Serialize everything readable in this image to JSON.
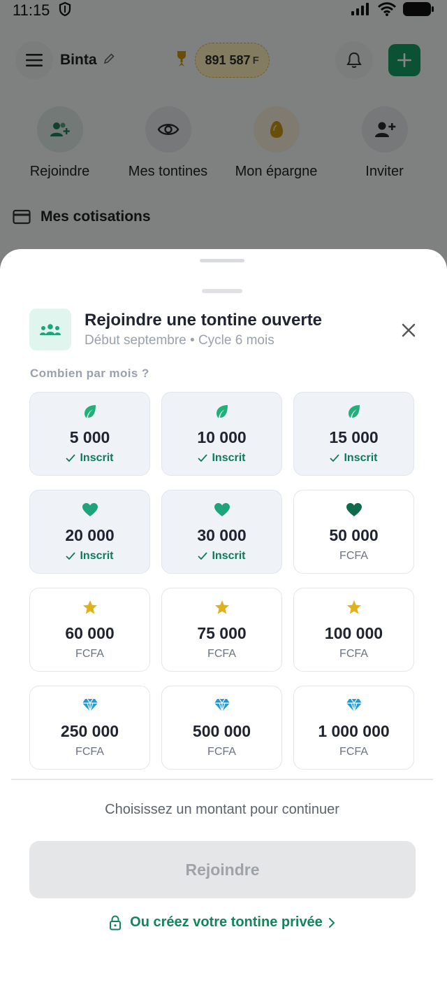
{
  "status_bar": {
    "time": "11:15"
  },
  "header": {
    "user_name": "Binta",
    "balance_amount": "891 587",
    "balance_currency": "F"
  },
  "quick_actions": [
    {
      "label": "Rejoindre",
      "icon": "user-plus-group-icon",
      "color": "#1d7f5a"
    },
    {
      "label": "Mes tontines",
      "icon": "eye-icon",
      "color": "#2b2b2b"
    },
    {
      "label": "Mon épargne",
      "icon": "egg-icon",
      "color": "#c99414"
    },
    {
      "label": "Inviter",
      "icon": "add-user-icon",
      "color": "#2b2b2b"
    }
  ],
  "section": {
    "title": "Mes cotisations"
  },
  "sheet": {
    "title": "Rejoindre une tontine ouverte",
    "subtitle": "Début septembre • Cycle 6 mois",
    "question": "Combien par mois ?",
    "options": [
      {
        "amount": "5 000",
        "tier_icon": "leaf-icon",
        "subscribed": true,
        "footer": "Inscrit"
      },
      {
        "amount": "10 000",
        "tier_icon": "leaf-icon",
        "subscribed": true,
        "footer": "Inscrit"
      },
      {
        "amount": "15 000",
        "tier_icon": "leaf-icon",
        "subscribed": true,
        "footer": "Inscrit"
      },
      {
        "amount": "20 000",
        "tier_icon": "heart-icon",
        "subscribed": true,
        "footer": "Inscrit"
      },
      {
        "amount": "30 000",
        "tier_icon": "heart-icon",
        "subscribed": true,
        "footer": "Inscrit"
      },
      {
        "amount": "50 000",
        "tier_icon": "heart-icon",
        "subscribed": false,
        "footer": "FCFA"
      },
      {
        "amount": "60 000",
        "tier_icon": "star-icon",
        "subscribed": false,
        "footer": "FCFA"
      },
      {
        "amount": "75 000",
        "tier_icon": "star-icon",
        "subscribed": false,
        "footer": "FCFA"
      },
      {
        "amount": "100 000",
        "tier_icon": "star-icon",
        "subscribed": false,
        "footer": "FCFA"
      },
      {
        "amount": "250 000",
        "tier_icon": "diamond-icon",
        "subscribed": false,
        "footer": "FCFA"
      },
      {
        "amount": "500 000",
        "tier_icon": "diamond-icon",
        "subscribed": false,
        "footer": "FCFA"
      },
      {
        "amount": "1 000 000",
        "tier_icon": "diamond-icon",
        "subscribed": false,
        "footer": "FCFA"
      }
    ],
    "hint": "Choisissez un montant pour continuer",
    "join_button": "Rejoindre",
    "private_link": "Ou créez votre tontine privée"
  },
  "colors": {
    "brand_green": "#169e64",
    "leaf_green": "#22b07a",
    "heart_green_light": "#1fa37a",
    "heart_green_dark": "#0f6b4c",
    "star_gold": "#e0b11a",
    "diamond_blue": "#1e9bd7"
  }
}
